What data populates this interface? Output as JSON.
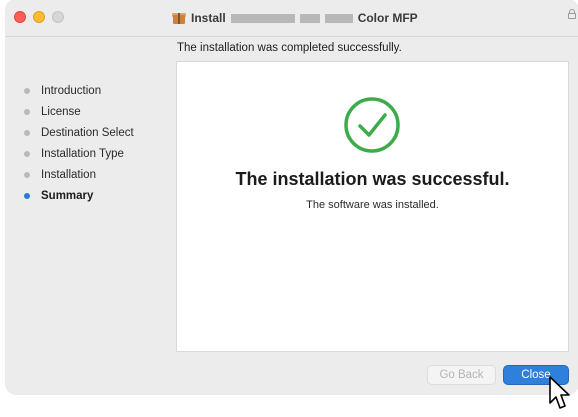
{
  "window": {
    "title_prefix": "Install",
    "title_suffix": "Color MFP"
  },
  "heading": "The installation was completed successfully.",
  "sidebar": {
    "items": [
      {
        "label": "Introduction",
        "active": false
      },
      {
        "label": "License",
        "active": false
      },
      {
        "label": "Destination Select",
        "active": false
      },
      {
        "label": "Installation Type",
        "active": false
      },
      {
        "label": "Installation",
        "active": false
      },
      {
        "label": "Summary",
        "active": true
      }
    ]
  },
  "content": {
    "icon": "checkmark-circle-icon",
    "title": "The installation was successful.",
    "subtitle": "The software was installed."
  },
  "buttons": {
    "back_label": "Go Back",
    "close_label": "Close"
  },
  "colors": {
    "accent": "#2f7fdd",
    "success": "#3cab4a"
  }
}
